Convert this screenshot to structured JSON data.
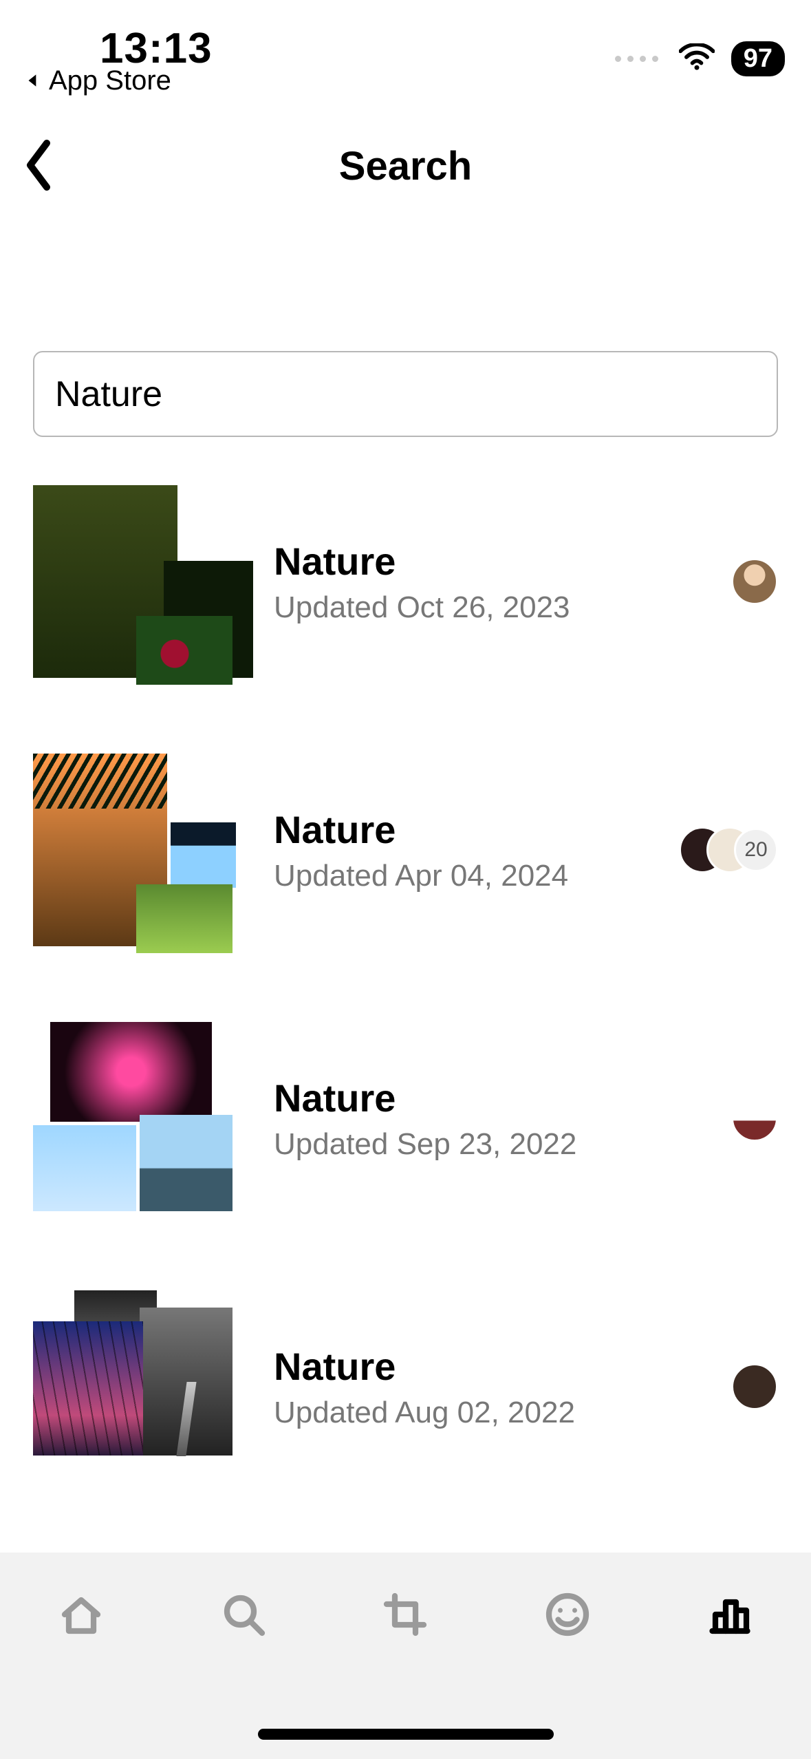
{
  "status": {
    "time": "13:13",
    "back_app_label": "App Store",
    "battery": "97"
  },
  "header": {
    "title": "Search"
  },
  "search": {
    "value": "Nature"
  },
  "results": [
    {
      "title": "Nature",
      "subtitle": "Updated Oct 26, 2023",
      "avatars": 1,
      "extra_count": null
    },
    {
      "title": "Nature",
      "subtitle": "Updated Apr 04, 2024",
      "avatars": 2,
      "extra_count": "20"
    },
    {
      "title": "Nature",
      "subtitle": "Updated Sep 23, 2022",
      "avatars": 1,
      "extra_count": null
    },
    {
      "title": "Nature",
      "subtitle": "Updated Aug 02, 2022",
      "avatars": 1,
      "extra_count": null
    }
  ],
  "tabbar": {
    "items": [
      "home",
      "search",
      "crop",
      "face",
      "stats"
    ],
    "active_index": 4
  }
}
